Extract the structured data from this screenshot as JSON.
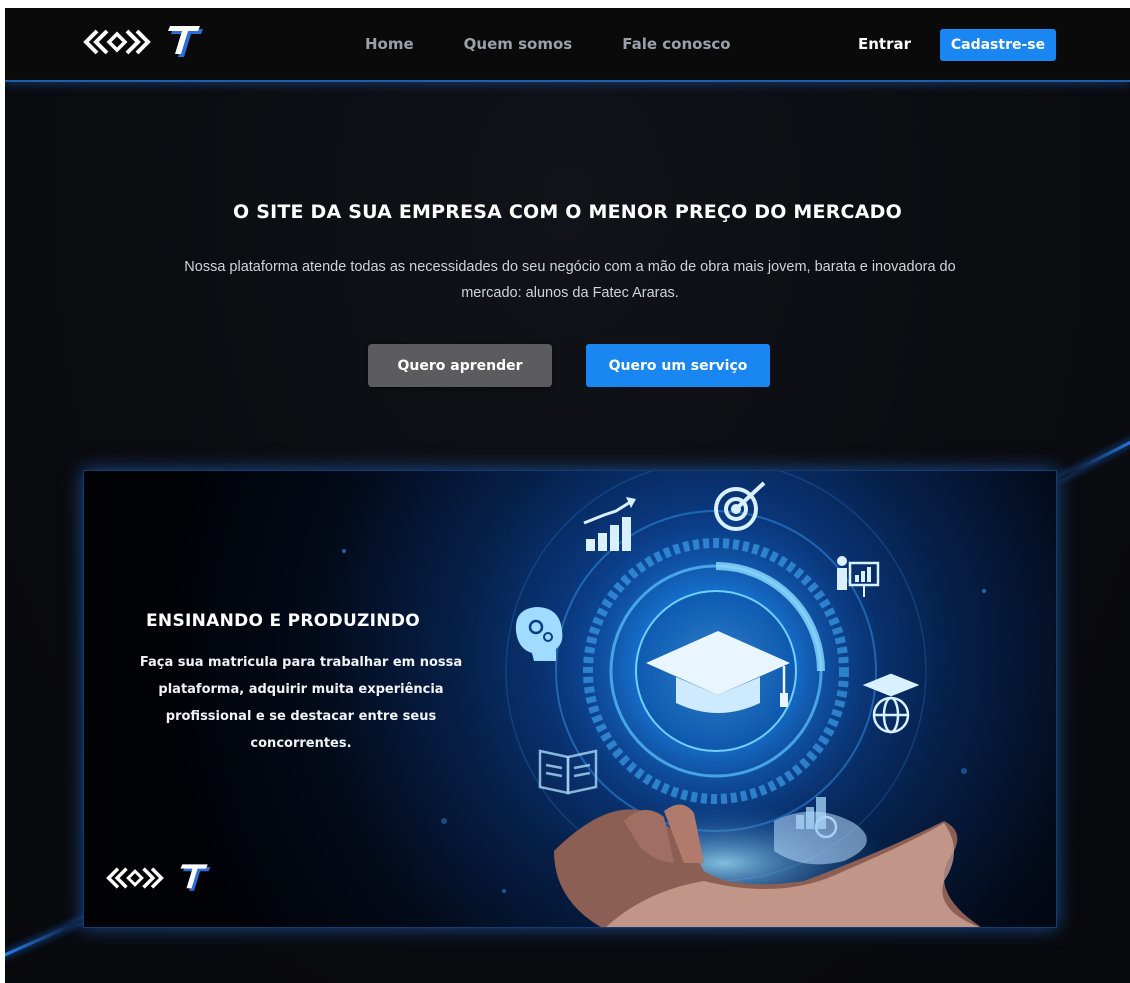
{
  "nav": {
    "links": [
      "Home",
      "Quem somos",
      "Fale conosco"
    ],
    "login_label": "Entrar",
    "signup_label": "Cadastre-se"
  },
  "hero": {
    "title": "O SITE DA SUA EMPRESA COM O MENOR PREÇO DO MERCADO",
    "subtitle": "Nossa plataforma atende todas as necessidades do seu negócio com a mão de obra mais jovem, barata e inovadora do mercado: alunos da Fatec Araras.",
    "learn_button": "Quero aprender",
    "service_button": "Quero um serviço"
  },
  "banner": {
    "title": "ENSINANDO E PRODUZINDO",
    "text": "Faça sua matricula para trabalhar em nossa plataforma, adquirir muita experiência profissional e se destacar entre seus concorrentes.",
    "icons": [
      "growth-chart-icon",
      "target-icon",
      "presentation-icon",
      "brain-gears-icon",
      "graduation-cap-icon",
      "globe-graduation-icon",
      "open-book-icon",
      "team-stats-icon",
      "open-hand-icon"
    ]
  },
  "colors": {
    "accent": "#1a86f2",
    "secondary_button": "#5c5c5e",
    "nav_background": "#0a0a0b",
    "page_background": "#0b0c10"
  }
}
